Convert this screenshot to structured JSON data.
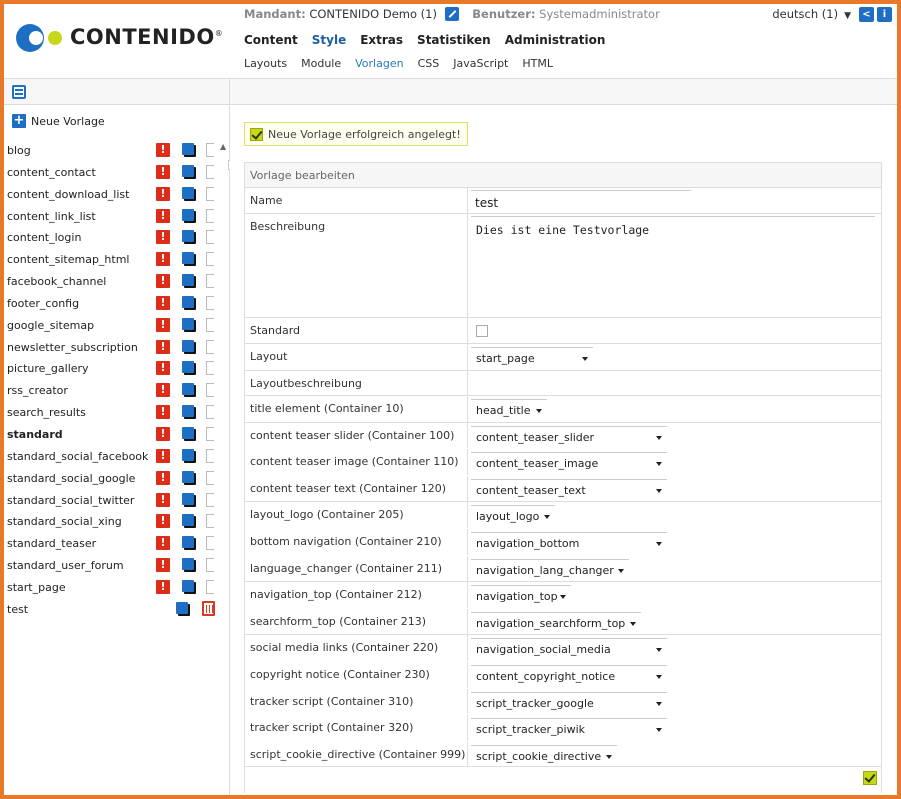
{
  "header": {
    "logo_text": "CONTENIDO",
    "logo_reg": "®",
    "mandant_label": "Mandant:",
    "mandant_value": "CONTENIDO Demo (1)",
    "user_label": "Benutzer:",
    "user_value": "Systemadministrator",
    "language": "deutsch (1)",
    "main_nav": [
      "Content",
      "Style",
      "Extras",
      "Statistiken",
      "Administration"
    ],
    "main_nav_active": "Style",
    "sub_nav": [
      "Layouts",
      "Module",
      "Vorlagen",
      "CSS",
      "JavaScript",
      "HTML"
    ],
    "sub_nav_active": "Vorlagen",
    "icons": [
      "edit-icon",
      "share-icon",
      "info-icon"
    ]
  },
  "left": {
    "new_template_label": "Neue Vorlage",
    "templates": [
      {
        "name": "blog"
      },
      {
        "name": "content_contact"
      },
      {
        "name": "content_download_list"
      },
      {
        "name": "content_link_list"
      },
      {
        "name": "content_login"
      },
      {
        "name": "content_sitemap_html"
      },
      {
        "name": "facebook_channel"
      },
      {
        "name": "footer_config"
      },
      {
        "name": "google_sitemap"
      },
      {
        "name": "newsletter_subscription"
      },
      {
        "name": "picture_gallery"
      },
      {
        "name": "rss_creator"
      },
      {
        "name": "search_results"
      },
      {
        "name": "standard"
      },
      {
        "name": "standard_social_facebook"
      },
      {
        "name": "standard_social_google"
      },
      {
        "name": "standard_social_twitter"
      },
      {
        "name": "standard_social_xing"
      },
      {
        "name": "standard_teaser"
      },
      {
        "name": "standard_user_forum"
      },
      {
        "name": "start_page"
      },
      {
        "name": "test"
      }
    ]
  },
  "right": {
    "success_message": "Neue Vorlage erfolgreich angelegt!",
    "form_title": "Vorlage bearbeiten",
    "name_label": "Name",
    "name_value": "test",
    "description_label": "Beschreibung",
    "description_value": "Dies ist eine Testvorlage",
    "standard_label": "Standard",
    "standard_checked": false,
    "layout_label": "Layout",
    "layout_value": "start_page",
    "layout_description_label": "Layoutbeschreibung",
    "containers": [
      {
        "label": "title element (Container 10)",
        "value": "head_title"
      },
      {
        "label": "content teaser slider (Container 100)",
        "value": "content_teaser_slider"
      },
      {
        "label": "content teaser image (Container 110)",
        "value": "content_teaser_image"
      },
      {
        "label": "content teaser text (Container 120)",
        "value": "content_teaser_text"
      },
      {
        "label": "layout_logo (Container 205)",
        "value": "layout_logo"
      },
      {
        "label": "bottom navigation (Container 210)",
        "value": "navigation_bottom"
      },
      {
        "label": "language_changer (Container 211)",
        "value": "navigation_lang_changer"
      },
      {
        "label": "navigation_top (Container 212)",
        "value": "navigation_top"
      },
      {
        "label": "searchform_top (Container 213)",
        "value": "navigation_searchform_top"
      },
      {
        "label": "social media links (Container 220)",
        "value": "navigation_social_media"
      },
      {
        "label": "copyright notice (Container 230)",
        "value": "content_copyright_notice"
      },
      {
        "label": "tracker script (Container 310)",
        "value": "script_tracker_google"
      },
      {
        "label": "tracker script (Container 320)",
        "value": "script_tracker_piwik"
      },
      {
        "label": "script_cookie_directive (Container 999)",
        "value": "script_cookie_directive"
      }
    ]
  },
  "colors": {
    "frame_border": "#e8782a",
    "accent_blue": "#1e6fc4",
    "warning_red": "#dd2c18",
    "success_green": "#c7d81c"
  }
}
